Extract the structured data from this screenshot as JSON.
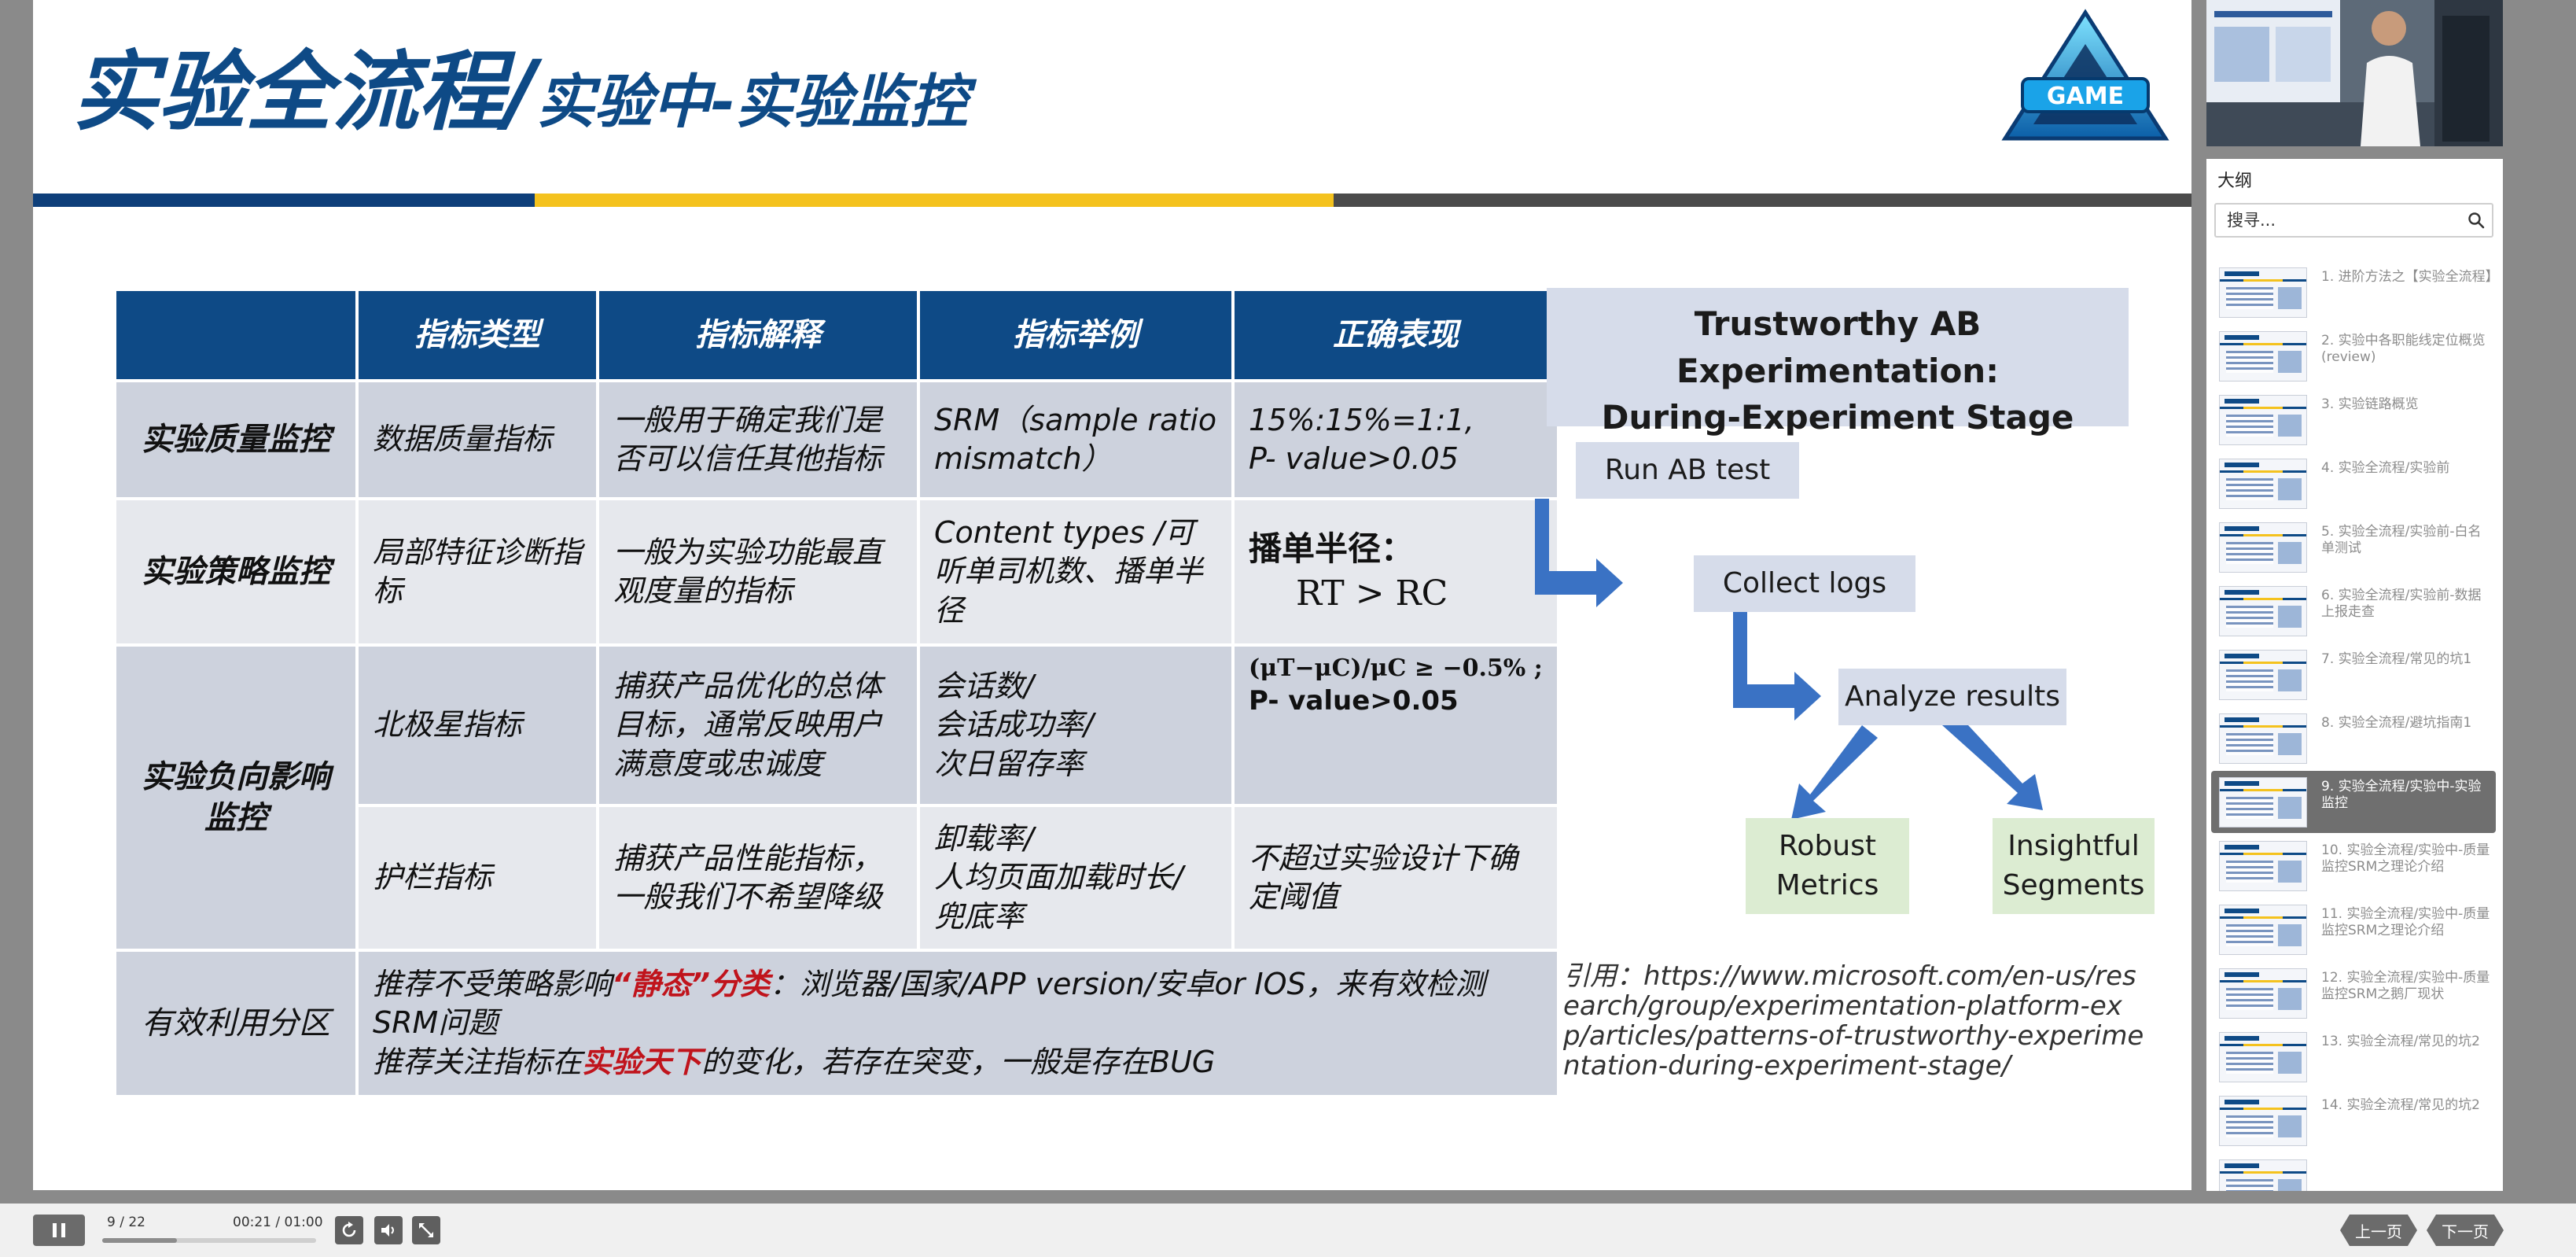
{
  "slide": {
    "title_big": "实验全流程/",
    "title_small": "实验中-实验监控",
    "table": {
      "headers": [
        "",
        "指标类型",
        "指标解释",
        "指标举例",
        "正确表现"
      ],
      "row1": {
        "group": "实验质量监控",
        "type": "数据质量指标",
        "explain": "一般用于确定我们是否可以信任其他指标",
        "example": "SRM（sample ratio mismatch）",
        "expect_line1": "15%:15%=1:1,",
        "expect_line2": "P- value>0.05"
      },
      "row2": {
        "group": "实验策略监控",
        "type": "局部特征诊断指标",
        "explain": "一般为实验功能最直观度量的指标",
        "example": "Content types /可听单司机数、播单半径",
        "expect_line1": "播单半径：",
        "expect_line2": "RT > RC"
      },
      "row3": {
        "group": "实验负向影响监控",
        "type": "北极星指标",
        "explain": "捕获产品优化的总体目标，通常反映用户满意度或忠诚度",
        "example_line1": "会话数/",
        "example_line2": "会话成功率/",
        "example_line3": "次日留存率",
        "expect_line1": "(μT−μC)/μC ≥ −0.5%  ;",
        "expect_line2": "P- value>0.05"
      },
      "row4": {
        "type": "护栏指标",
        "explain": "捕获产品性能指标，一般我们不希望降级",
        "example_line1": "卸载率/",
        "example_line2": "人均页面加载时长/",
        "example_line3": "兜底率",
        "expect": "不超过实验设计下确定阈值"
      },
      "row5": {
        "group": "有效利用分区",
        "line1_pre": "推荐不受策略影响",
        "line1_em": "“静态”分类",
        "line1_post": "：浏览器/国家/APP version/安卓or IOS，来有效检测SRM问题",
        "line2_pre": "推荐关注指标在",
        "line2_em": "实验天下",
        "line2_post": "的变化，若存在突变，一般是存在BUG"
      }
    },
    "diagram": {
      "title_line1": "Trustworthy AB Experimentation:",
      "title_line2": "During-Experiment Stage",
      "step1": "Run AB test",
      "step2": "Collect logs",
      "step3": "Analyze results",
      "out1": "Robust Metrics",
      "out2": "Insightful Segments"
    },
    "citation": "引用：https://www.microsoft.com/en-us/research/group/experimentation-platform-exp/articles/patterns-of-trustworthy-experimentation-during-experiment-stage/"
  },
  "sidebar": {
    "outline_label": "大纲",
    "search_placeholder": "搜寻...",
    "items": [
      {
        "label": "1. 进阶方法之【实验全流程】"
      },
      {
        "label": "2. 实验中各职能线定位概览(review)"
      },
      {
        "label": "3. 实验链路概览"
      },
      {
        "label": "4. 实验全流程/实验前"
      },
      {
        "label": "5. 实验全流程/实验前-白名单测试"
      },
      {
        "label": "6. 实验全流程/实验前-数据上报走查"
      },
      {
        "label": "7. 实验全流程/常见的坑1"
      },
      {
        "label": "8. 实验全流程/避坑指南1"
      },
      {
        "label": "9. 实验全流程/实验中-实验监控"
      },
      {
        "label": "10. 实验全流程/实验中-质量监控SRM之理论介绍"
      },
      {
        "label": "11. 实验全流程/实验中-质量监控SRM之理论介绍"
      },
      {
        "label": "12. 实验全流程/实验中-质量监控SRM之鹅厂现状"
      },
      {
        "label": "13. 实验全流程/常见的坑2"
      },
      {
        "label": "14. 实验全流程/常见的坑2"
      },
      {
        "label": ""
      }
    ],
    "active_index": 8
  },
  "player": {
    "page_counter": "9 / 22",
    "time": "00:21 / 01:00",
    "progress": 0.35,
    "prev_label": "上一页",
    "next_label": "下一页"
  },
  "colors": {
    "title_blue": "#0e4a86",
    "header_blue": "#0e3f7a",
    "accent_yellow": "#f4c21e",
    "emphasis_red": "#c0141c",
    "flow_box": "#d6dcea",
    "flow_box_green": "#dcecd2",
    "arrow_blue": "#3a72c4"
  },
  "icons": [
    "pause-icon",
    "replay-icon",
    "volume-icon",
    "fullscreen-icon",
    "search-icon",
    "game-logo"
  ]
}
